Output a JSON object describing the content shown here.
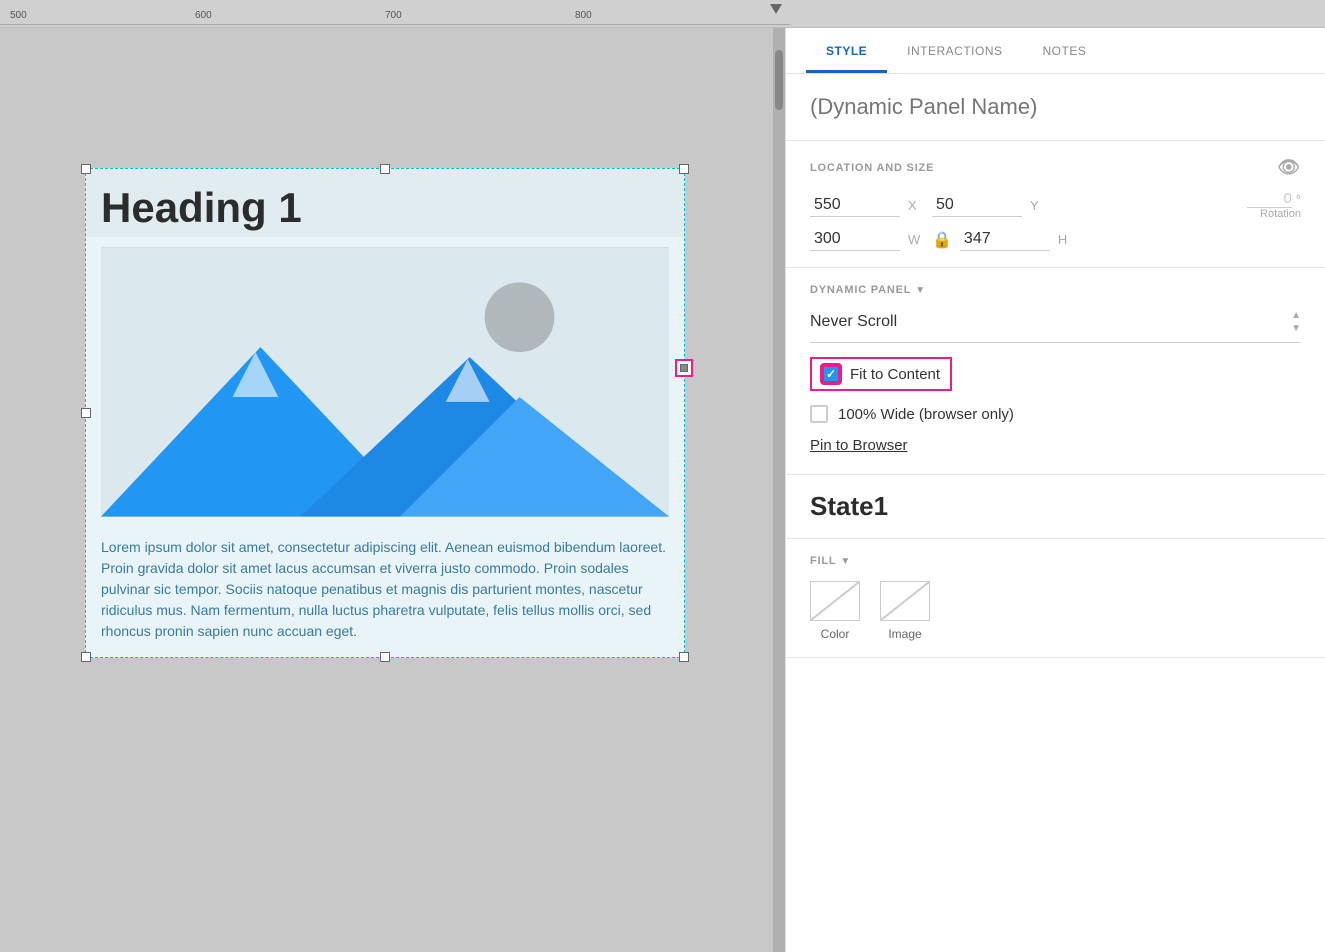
{
  "ruler": {
    "marks": [
      "500",
      "600",
      "700",
      "800"
    ]
  },
  "tabs": {
    "items": [
      "STYLE",
      "INTERACTIONS",
      "NOTES"
    ],
    "active": 0
  },
  "panel_name": {
    "placeholder": "(Dynamic Panel Name)"
  },
  "location_size": {
    "label": "LOCATION AND SIZE",
    "x_value": "550",
    "x_label": "X",
    "y_value": "50",
    "y_label": "Y",
    "rotation_value": "0",
    "rotation_symbol": "°",
    "rotation_label": "Rotation",
    "w_value": "300",
    "w_label": "W",
    "h_value": "347",
    "h_label": "H"
  },
  "dynamic_panel": {
    "label": "DYNAMIC PANEL",
    "scroll_value": "Never Scroll",
    "fit_to_content_label": "Fit to Content",
    "wide_label": "100% Wide (browser only)",
    "pin_label": "Pin to Browser"
  },
  "state": {
    "title": "State1"
  },
  "fill": {
    "label": "FILL",
    "color_label": "Color",
    "image_label": "Image"
  },
  "widget": {
    "heading": "Heading 1",
    "text": "Lorem ipsum dolor sit amet, consectetur adipiscing elit. Aenean euismod bibendum laoreet. Proin gravida dolor sit amet lacus accumsan et viverra justo commodo. Proin sodales pulvinar sic tempor. Sociis natoque penatibus et magnis dis parturient montes, nascetur ridiculus mus. Nam fermentum, nulla luctus pharetra vulputate, felis tellus mollis orci, sed rhoncus pronin sapien nunc accuan eget."
  }
}
